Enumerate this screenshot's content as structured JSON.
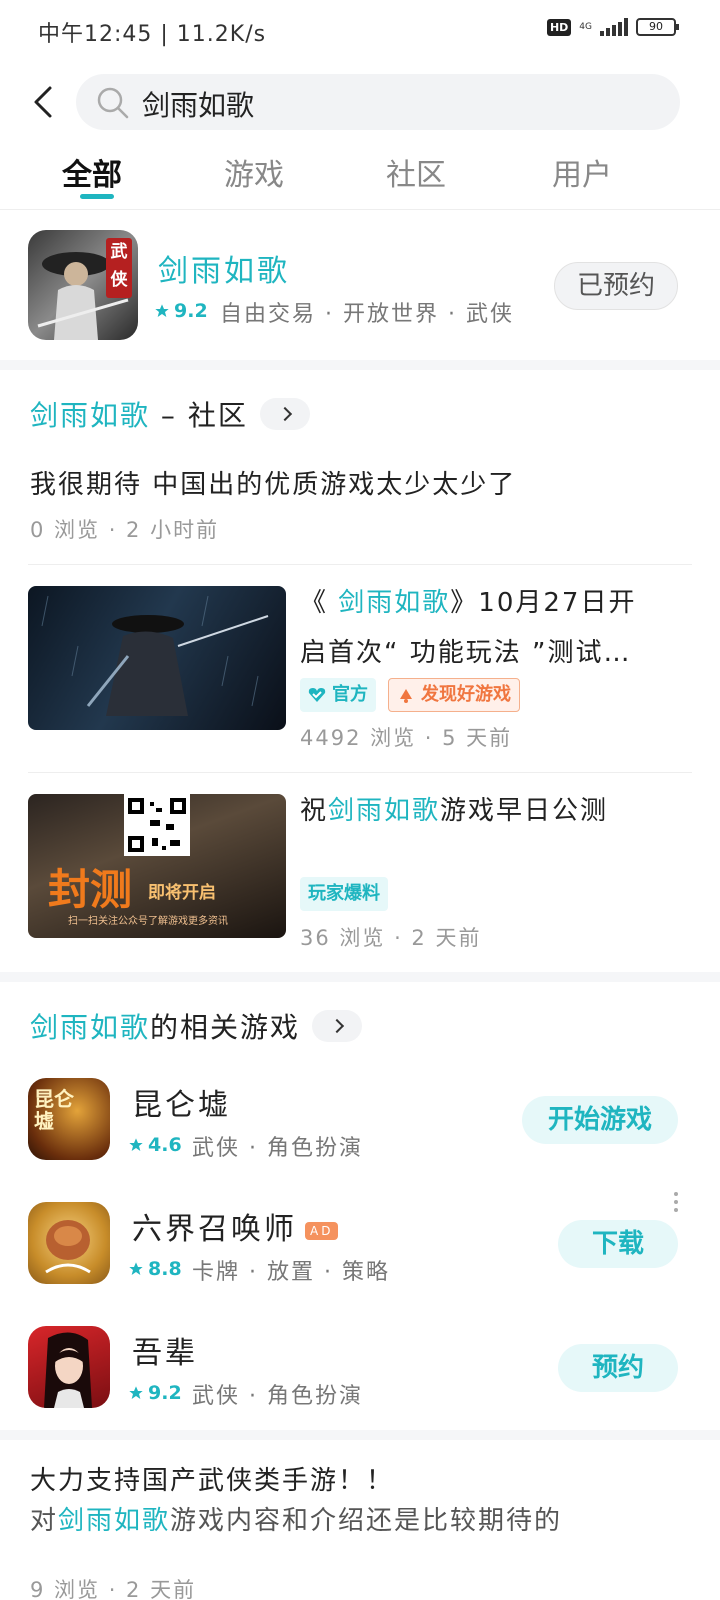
{
  "status": {
    "time": "中午12:45 | 11.2K/s",
    "hd": "HD",
    "network": "4G",
    "battery": "90"
  },
  "search": {
    "query": "剑雨如歌"
  },
  "tabs": [
    "全部",
    "游戏",
    "社区",
    "用户"
  ],
  "main_game": {
    "name": "剑雨如歌",
    "rating": "9.2",
    "tags": "自由交易 · 开放世界 · 武侠",
    "button": "已预约",
    "icon_label": "武侠"
  },
  "community": {
    "title_prefix": "剑雨如歌",
    "title_suffix": " – 社区",
    "post1": {
      "title": "我很期待 中国出的优质游戏太少太少了",
      "meta": "0 浏览 · 2 小时前"
    },
    "post2": {
      "title_pre": "《 ",
      "title_highlight": "剑雨如歌",
      "title_post1": "》10月27日开",
      "title_line2": "启首次“ 功能玩法 ”测试…",
      "badge_official": "官方",
      "badge_discover": "发现好游戏",
      "meta": "4492 浏览 · 5 天前"
    },
    "post3": {
      "title_pre": "祝",
      "title_highlight": "剑雨如歌",
      "title_post": "游戏早日公测",
      "badge": "玩家爆料",
      "meta": "36 浏览 · 2 天前",
      "thumb_text": "封测",
      "thumb_sub": "即将开启",
      "thumb_foot": "扫一扫关注公众号了解游戏更多资讯"
    }
  },
  "related": {
    "title_highlight": "剑雨如歌",
    "title_suffix": "的相关游戏",
    "games": [
      {
        "name": "昆仑墟",
        "rating": "4.6",
        "tags": "武侠 · 角色扮演",
        "button": "开始游戏",
        "ad": "",
        "icon_text": "昆仑墟"
      },
      {
        "name": "六界召唤师",
        "rating": "8.8",
        "tags": "卡牌 · 放置 · 策略",
        "button": "下载",
        "ad": "AD",
        "icon_text": ""
      },
      {
        "name": "吾辈",
        "rating": "9.2",
        "tags": "武侠 · 角色扮演",
        "button": "预约",
        "ad": "",
        "icon_text": ""
      }
    ]
  },
  "bottom_post": {
    "title": "大力支持国产武侠类手游！！",
    "line2_pre": "对",
    "line2_highlight": "剑雨如歌",
    "line2_post": "游戏内容和介绍还是比较期待的",
    "meta": "9 浏览 · 2 天前"
  },
  "colors": {
    "accent": "#1fb5c0",
    "orange": "#f07640"
  }
}
